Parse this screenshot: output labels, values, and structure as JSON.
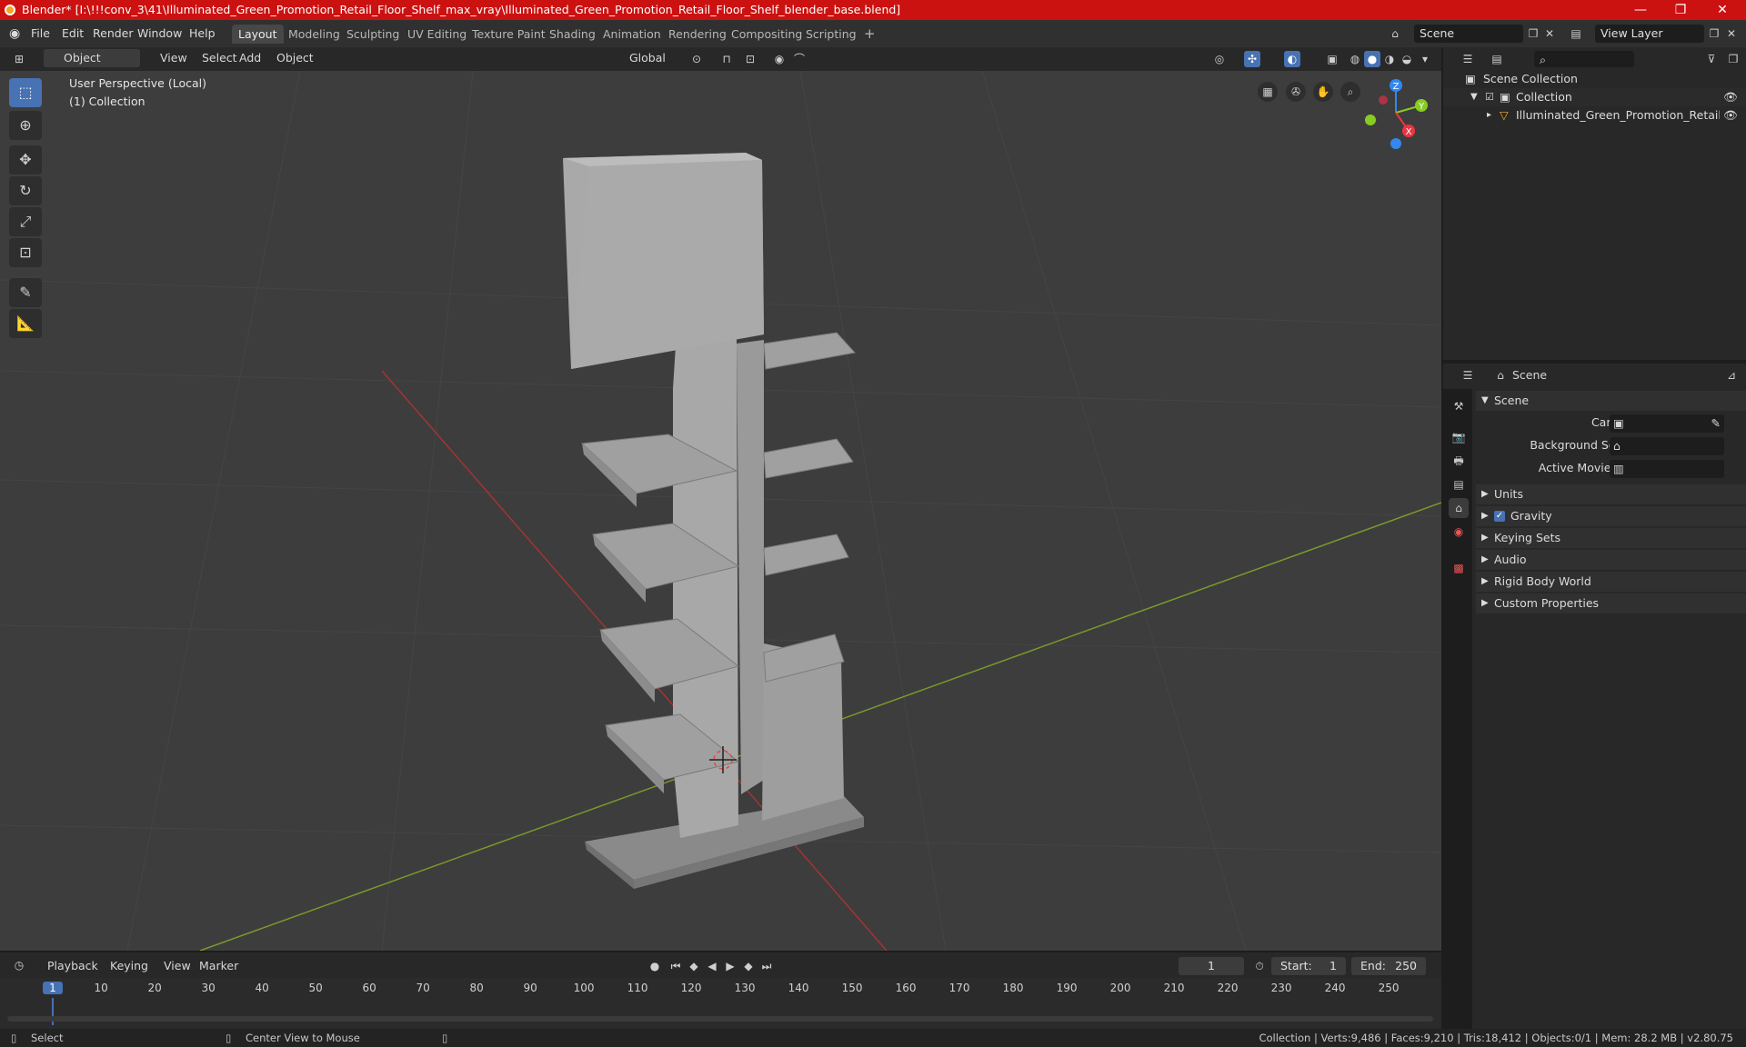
{
  "titlebar": {
    "title": "Blender* [I:\\!!!conv_3\\41\\Illuminated_Green_Promotion_Retail_Floor_Shelf_max_vray\\Illuminated_Green_Promotion_Retail_Floor_Shelf_blender_base.blend]",
    "minimize": "—",
    "maximize": "❐",
    "close": "✕"
  },
  "menubar": {
    "menus": [
      "File",
      "Edit",
      "Render",
      "Window",
      "Help"
    ],
    "workspaces": [
      "Layout",
      "Modeling",
      "Sculpting",
      "UV Editing",
      "Texture Paint",
      "Shading",
      "Animation",
      "Rendering",
      "Compositing",
      "Scripting"
    ],
    "active_workspace": "Layout",
    "add_tab": "+",
    "scene_name": "Scene",
    "view_layer": "View Layer"
  },
  "viewport_header": {
    "mode": "Object Mode",
    "menus": [
      "View",
      "Select",
      "Add",
      "Object"
    ],
    "transform_orientation": "Global"
  },
  "viewport": {
    "perspective_label": "User Perspective (Local)",
    "collection_label": "(1) Collection",
    "gizmo_axes": {
      "x": "X",
      "y": "Y",
      "z": "Z"
    }
  },
  "outliner": {
    "root": "Scene Collection",
    "collection": "Collection",
    "object": "Illuminated_Green_Promotion_Retail_Floor_S"
  },
  "properties": {
    "header_title": "Scene",
    "panel_title": "Scene",
    "camera_label": "Camera",
    "background_scene_label": "Background Scene",
    "active_movie_clip_label": "Active Movie Clip",
    "sections": [
      "Units",
      "Gravity",
      "Keying Sets",
      "Audio",
      "Rigid Body World",
      "Custom Properties"
    ],
    "gravity_checked": true
  },
  "timeline": {
    "menus": [
      "Playback",
      "Keying",
      "View",
      "Marker"
    ],
    "current_frame": "1",
    "start_label": "Start:",
    "start_value": "1",
    "end_label": "End:",
    "end_value": "250",
    "ticks": [
      "1",
      "10",
      "20",
      "30",
      "40",
      "50",
      "60",
      "70",
      "80",
      "90",
      "100",
      "110",
      "120",
      "130",
      "140",
      "150",
      "160",
      "170",
      "180",
      "190",
      "200",
      "210",
      "220",
      "230",
      "240",
      "250"
    ]
  },
  "statusbar": {
    "left_action": "Select",
    "middle_action": "Center View to Mouse",
    "stats": "Collection | Verts:9,486 | Faces:9,210 | Tris:18,412 | Objects:0/1 | Mem: 28.2 MB | v2.80.75"
  },
  "colors": {
    "title_red": "#cc1111",
    "accent_blue": "#4772b3",
    "axis_x": "#ee3344",
    "axis_y": "#88cc22",
    "axis_z": "#3388ee"
  }
}
